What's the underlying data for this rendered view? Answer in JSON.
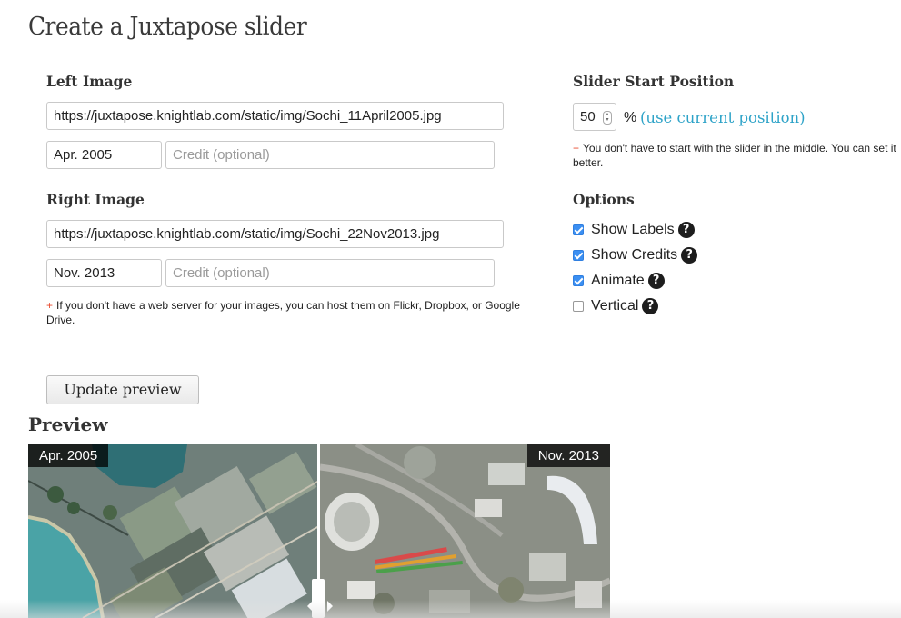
{
  "page": {
    "title": "Create a Juxtapose slider"
  },
  "left_image": {
    "heading": "Left Image",
    "url_value": "https://juxtapose.knightlab.com/static/img/Sochi_11April2005.jpg",
    "label_value": "Apr. 2005",
    "credit_placeholder": "Credit (optional)"
  },
  "right_image": {
    "heading": "Right Image",
    "url_value": "https://juxtapose.knightlab.com/static/img/Sochi_22Nov2013.jpg",
    "label_value": "Nov. 2013",
    "credit_placeholder": "Credit (optional)"
  },
  "host_note": {
    "plus": "+",
    "text": "If you don't have a web server for your images, you can host them on Flickr, Dropbox, or Google Drive."
  },
  "slider_start": {
    "heading": "Slider Start Position",
    "value": "50",
    "percent_sign": "%",
    "use_current_link": "(use current position)",
    "note_plus": "+",
    "note_text": "You don't have to start with the slider in the middle. You can set it",
    "note_text_2": "better."
  },
  "options": {
    "heading": "Options",
    "items": [
      {
        "label": "Show Labels",
        "checked": true
      },
      {
        "label": "Show Credits",
        "checked": true
      },
      {
        "label": "Animate",
        "checked": true
      },
      {
        "label": "Vertical",
        "checked": false
      }
    ],
    "help_glyph": "?"
  },
  "update_button": {
    "label": "Update preview"
  },
  "preview": {
    "heading": "Preview",
    "left_label": "Apr. 2005",
    "right_label": "Nov. 2013",
    "slider_position_percent": 50
  },
  "colors": {
    "link": "#2ea3c8",
    "checkbox": "#3b8ff2",
    "note_plus": "#e8492d"
  }
}
